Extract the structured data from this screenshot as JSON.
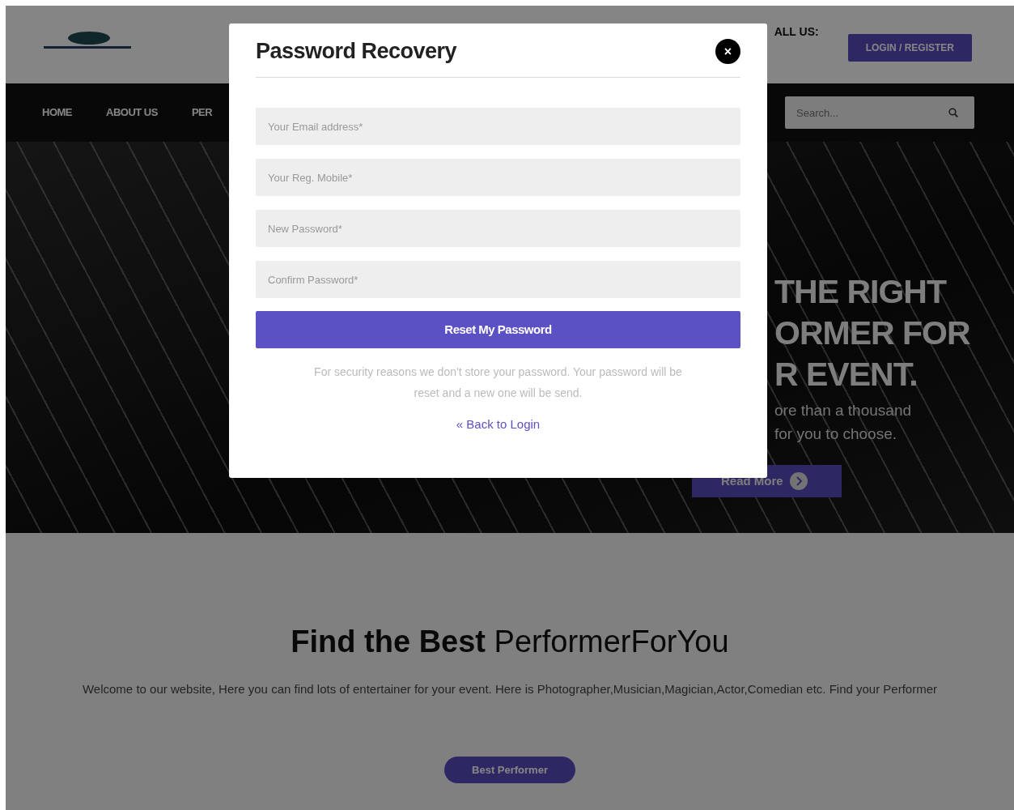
{
  "header": {
    "contact_label": "ALL US:",
    "login_button": "LOGIN / REGISTER"
  },
  "nav": {
    "items": [
      {
        "label": "HOME"
      },
      {
        "label": "ABOUT US"
      },
      {
        "label": "PER"
      }
    ],
    "search": {
      "placeholder": "Search..."
    }
  },
  "hero": {
    "headline_lines": [
      "THE RIGHT",
      "ORMER FOR",
      "R EVENT."
    ],
    "subtitle_lines": [
      "ore than a thousand",
      "for you to choose."
    ],
    "button": "Read More"
  },
  "intro": {
    "title": "**Find the Best** PerformerForYou",
    "text": "Welcome to our website, Here you can find lots of entertainer for your event. Here is Photographer,Musician,Magician,Actor,Comedian etc. Find your Performer",
    "button": "Best Performer"
  },
  "modal": {
    "title": "Password Recovery",
    "close": "×",
    "fields": [
      {
        "placeholder": "Your Email address*"
      },
      {
        "placeholder": "Your Reg. Mobile*"
      },
      {
        "placeholder": "New Password*"
      },
      {
        "placeholder": "Confirm Password*"
      }
    ],
    "submit": "Reset My Password",
    "note": "For security reasons we don't store your password. Your password will be reset and a new one will be send.",
    "back_link": "« Back to Login"
  }
}
